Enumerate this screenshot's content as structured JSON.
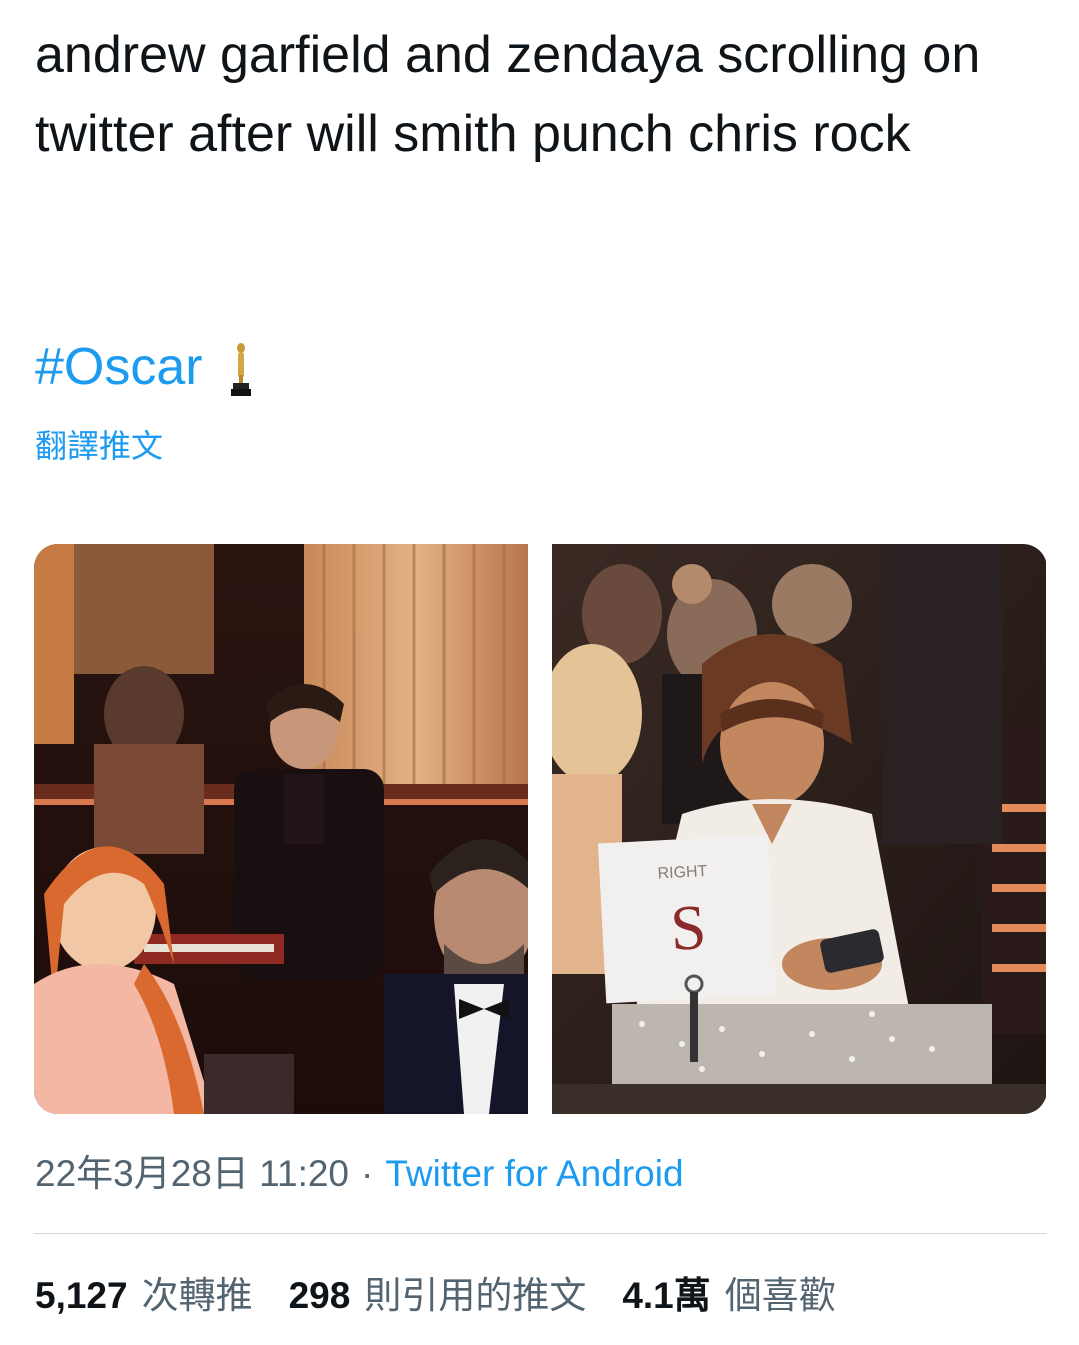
{
  "tweet": {
    "text": "andrew garfield and zendaya scrolling on twitter after will smith punch chris rock",
    "hashtag": "#Oscar",
    "translate_label": "翻譯推文",
    "timestamp": "22年3月28日 11:20",
    "separator": "·",
    "source": "Twitter for Android"
  },
  "media": {
    "left_image": "photo of Andrew Garfield at the Oscars",
    "right_image": "photo of Zendaya looking at phone at the Oscars",
    "card_text": "RIGHT",
    "card_letter": "S"
  },
  "stats": {
    "retweets_count": "5,127",
    "retweets_label": "次轉推",
    "quotes_count": "298",
    "quotes_label": "則引用的推文",
    "likes_count": "4.1萬",
    "likes_label": "個喜歡"
  },
  "colors": {
    "link": "#1d9bf0",
    "text": "#0f1419",
    "secondary": "#536471",
    "divider": "#cfd9de"
  },
  "icons": {
    "oscar": "oscar-statuette-icon"
  }
}
